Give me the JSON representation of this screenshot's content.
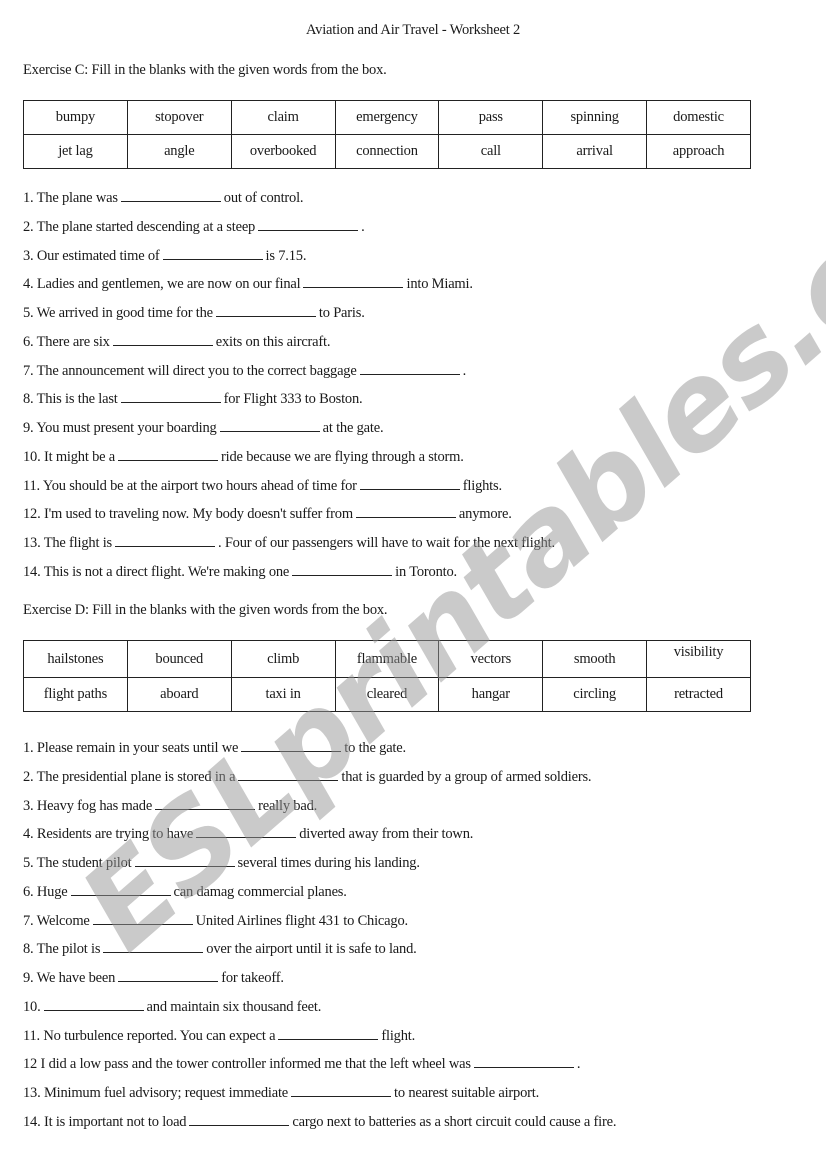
{
  "title": "Aviation and Air Travel - Worksheet 2",
  "watermark": "ESLprintables.com",
  "exercise_c": {
    "heading": "Exercise C: Fill in the blanks with the given words from the box.",
    "word_box": [
      [
        "bumpy",
        "stopover",
        "claim",
        "emergency",
        "pass",
        "spinning",
        "domestic"
      ],
      [
        "jet lag",
        "angle",
        "overbooked",
        "connection",
        "call",
        "arrival",
        "approach"
      ]
    ],
    "items": [
      {
        "before": "1. The plane was",
        "after": "out of control."
      },
      {
        "before": "2. The plane started descending at a steep",
        "after": "."
      },
      {
        "before": "3. Our estimated time of",
        "after": "is 7.15."
      },
      {
        "before": "4. Ladies and gentlemen, we are now on our final",
        "after": "into Miami."
      },
      {
        "before": "5. We arrived in good time for the",
        "after": "to Paris."
      },
      {
        "before": "6. There are six",
        "after": "exits on this aircraft."
      },
      {
        "before": "7. The announcement will direct you to the correct baggage",
        "after": "."
      },
      {
        "before": "8. This is the last",
        "after": "for Flight 333 to Boston."
      },
      {
        "before": "9. You must present your boarding",
        "after": "at the gate."
      },
      {
        "before": "10. It might be a",
        "after": "ride because we are flying through a storm."
      },
      {
        "before": "11. You should be at the airport two hours ahead of time for",
        "after": "flights."
      },
      {
        "before": "12. I'm used to traveling now. My body doesn't suffer from",
        "after": "anymore."
      },
      {
        "before": "13. The flight is",
        "after": ". Four of our passengers will have to wait for the next flight."
      },
      {
        "before": "14. This is not a direct flight. We're making one",
        "after": "in Toronto."
      }
    ]
  },
  "exercise_d": {
    "heading": "Exercise D: Fill in the blanks with the given words from the box.",
    "word_box": [
      [
        "hailstones",
        "bounced",
        "climb",
        "flammable",
        "vectors",
        "smooth",
        "visibility"
      ],
      [
        "flight paths",
        "aboard",
        "taxi in",
        "cleared",
        "hangar",
        "circling",
        "retracted"
      ]
    ],
    "items": [
      {
        "before": "1. Please remain in your seats until we",
        "after": "to the gate."
      },
      {
        "before": "2. The presidential plane is stored in a",
        "after": "that is guarded by a group of armed soldiers."
      },
      {
        "before": "3. Heavy fog has made",
        "after": "really bad."
      },
      {
        "before": "4. Residents are trying to have",
        "after": "diverted away from their town."
      },
      {
        "before": "5. The student pilot",
        "after": "several times during his landing."
      },
      {
        "before": "6. Huge",
        "after": "can damag commercial planes."
      },
      {
        "before": "7. Welcome",
        "after": "United Airlines flight 431 to Chicago."
      },
      {
        "before": "8. The pilot is",
        "after": "over the airport until it is safe to land."
      },
      {
        "before": "9. We have been",
        "after": "for takeoff."
      },
      {
        "before": "10.",
        "after": "and maintain six thousand feet."
      },
      {
        "before": "11. No turbulence reported. You can expect a",
        "after": "flight."
      },
      {
        "before": "12 I did a low pass and the tower controller informed me that the left wheel was",
        "after": "."
      },
      {
        "before": "13. Minimum fuel advisory; request immediate",
        "after": "to nearest suitable airport."
      },
      {
        "before": "14. It is important not to load",
        "after": "cargo next to batteries as a short circuit could cause a fire."
      }
    ]
  }
}
